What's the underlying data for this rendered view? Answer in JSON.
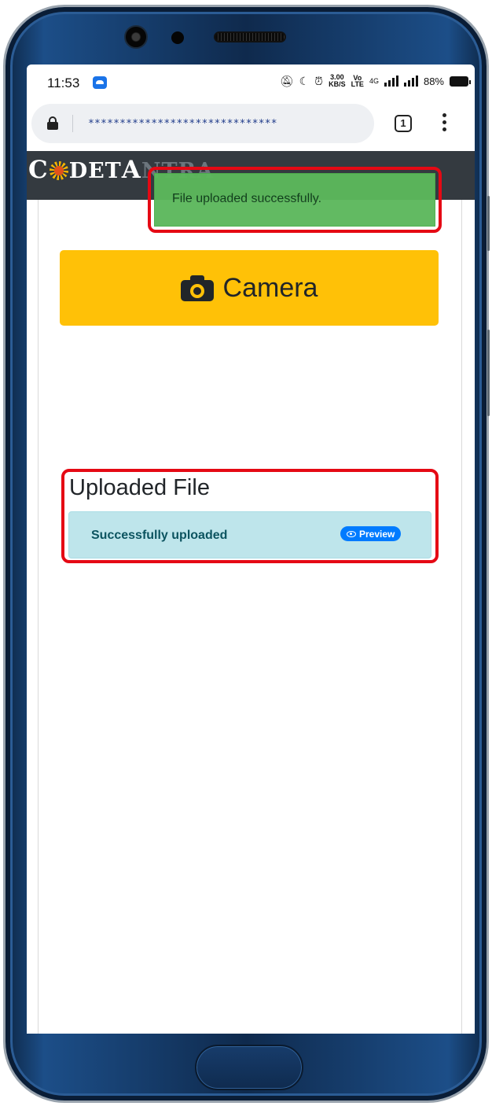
{
  "status_bar": {
    "time": "11:53",
    "network_speed_value": "3.00",
    "network_speed_unit": "KB/S",
    "volte_top": "Vo",
    "volte_bottom": "LTE",
    "network_type": "4G",
    "battery": "88%"
  },
  "browser": {
    "url": "******************************",
    "tab_count": "1"
  },
  "site": {
    "logo_first": "C",
    "logo_rest": "DET",
    "logo_big": "A",
    "logo_tail": "NTRA"
  },
  "toast": {
    "message": "File uploaded successfully."
  },
  "camera_button": {
    "label": "Camera"
  },
  "uploaded": {
    "title": "Uploaded File",
    "message": "Successfully uploaded",
    "preview_label": "Preview"
  },
  "colors": {
    "header": "#343a40",
    "camera_button": "#ffc107",
    "toast": "#5cb85c",
    "alert_info": "#bee5eb",
    "badge": "#007bff",
    "highlight": "#e50914",
    "phone_frame": "#1c4e88"
  },
  "icons": [
    "lock-icon",
    "camera-icon",
    "eye-icon",
    "kebab-menu-icon",
    "tab-switcher-icon",
    "notification-icon"
  ]
}
